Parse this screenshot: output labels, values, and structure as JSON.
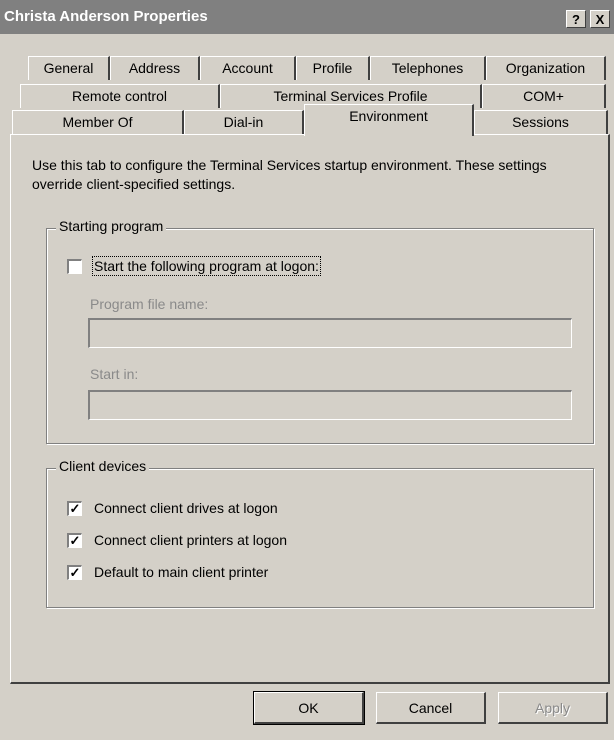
{
  "window": {
    "title": "Christa Anderson Properties",
    "help_button": "?",
    "close_button": "X"
  },
  "tabs": {
    "row1": [
      "General",
      "Address",
      "Account",
      "Profile",
      "Telephones",
      "Organization"
    ],
    "row2": [
      "Remote control",
      "Terminal Services Profile",
      "COM+"
    ],
    "row3": [
      "Member Of",
      "Dial-in",
      "Environment",
      "Sessions"
    ],
    "active": "Environment"
  },
  "description": "Use this tab to configure the Terminal Services startup environment. These settings override client-specified settings.",
  "starting_program": {
    "legend": "Starting program",
    "checkbox_label": "Start the following program at logon:",
    "checked": false,
    "program_label": "Program file name:",
    "program_value": "",
    "startin_label": "Start in:",
    "startin_value": ""
  },
  "client_devices": {
    "legend": "Client devices",
    "items": [
      {
        "label": "Connect client drives at logon",
        "checked": true
      },
      {
        "label": "Connect client printers at logon",
        "checked": true
      },
      {
        "label": "Default to main client printer",
        "checked": true
      }
    ]
  },
  "buttons": {
    "ok": "OK",
    "cancel": "Cancel",
    "apply": "Apply"
  },
  "check_mark": "✓"
}
